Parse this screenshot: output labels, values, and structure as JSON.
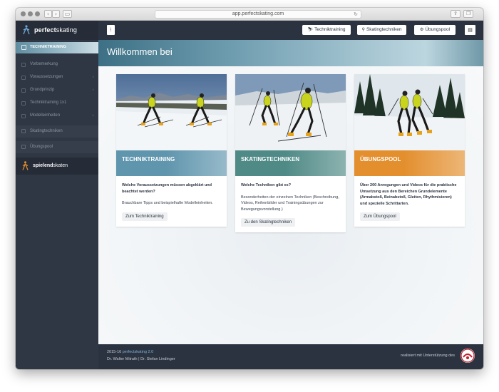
{
  "browser": {
    "url": "app.perfectskating.com"
  },
  "brand": {
    "name_bold": "perfect",
    "name_rest": "skating"
  },
  "sidebar": {
    "active_item": "TECHNIKTRAINING",
    "sub_items": [
      {
        "label": "Vorbemerkung"
      },
      {
        "label": "Voraussetzungen"
      },
      {
        "label": "Grundprinzip"
      },
      {
        "label": "Techniktraining 1x1"
      },
      {
        "label": "Modelleinheiten"
      }
    ],
    "sections": [
      {
        "label": "Skatingtechniken"
      },
      {
        "label": "Übungspool"
      }
    ],
    "spielend": {
      "bold": "spielend",
      "rest": "skaten"
    }
  },
  "header": {
    "buttons": [
      {
        "label": "Techniktraining",
        "icon": "skis-icon"
      },
      {
        "label": "Skatingtechniken",
        "icon": "skier-icon"
      },
      {
        "label": "Übungspool",
        "icon": "gears-icon"
      }
    ]
  },
  "hero": {
    "title": "Willkommen bei"
  },
  "cards": [
    {
      "title": "TECHNIKTRAINING",
      "lead": "Welche Voraussetzungen müssen abgeklärt und beachtet werden?",
      "desc": "Brauchbare Tipps und beispielhafte Modelleinheiten.",
      "cta": "Zum Techniktraining",
      "banner_color": "#5f95ad"
    },
    {
      "title": "SKATINGTECHNIKEN",
      "lead": "Welche Techniken gibt es?",
      "desc": "Besonderheiten der einzelnen Techniken (Beschreibung, Videos, Reihenbilder und Trainingsübungen zur Bewegungsvorstellung.)",
      "cta": "Zu den Skatingtechniken",
      "banner_color": "#4f8a86"
    },
    {
      "title": "ÜBUNGSPOOL",
      "lead": "Über 200 Anregungen und Videos für die praktische Umsetzung aus den Bereichen Grundelemente (Armabstoß, Beinabstoß, Gleiten, Rhythmisieren) und spezielle Schrittarten.",
      "desc": "",
      "cta": "Zum Übungspool",
      "banner_color": "#e38f2e"
    }
  ],
  "footer": {
    "year": "2015-16",
    "product": "perfectskating 2.0",
    "authors": "Dr. Walter Mitrath | Dr. Stefan Lindinger",
    "credit": "realisiert mit Unterstützung des"
  }
}
